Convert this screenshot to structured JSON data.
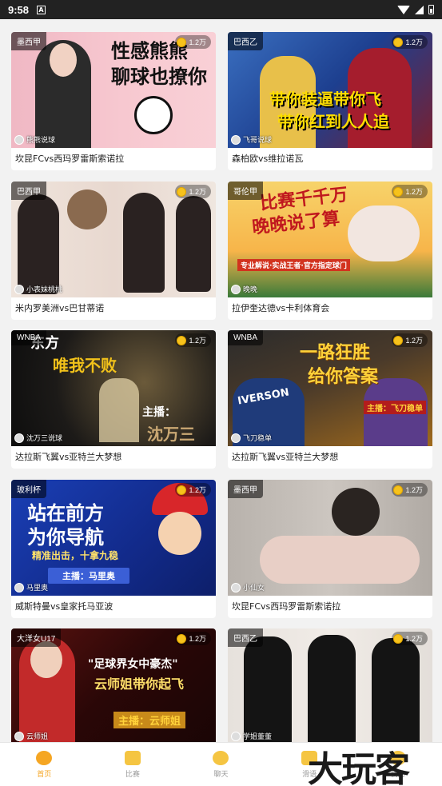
{
  "status_bar": {
    "time": "9:58",
    "notice_icon": "A"
  },
  "cards": [
    {
      "league": "墨西甲",
      "views": "1.2万",
      "anchor": "熊熊说球",
      "title": "坎昆FCvs西玛罗雷斯索诺拉",
      "poster": [
        "性感熊熊",
        "聊球也撩你"
      ]
    },
    {
      "league": "巴西乙",
      "views": "1.2万",
      "anchor": "飞哥说球",
      "title": "森柏欧vs维拉诺瓦",
      "poster": [
        "带你装逼带你飞",
        "带你红到人人追"
      ]
    },
    {
      "league": "巴西甲",
      "views": "1.2万",
      "anchor": "小表妹桃桃",
      "title": "米内罗美洲vs巴甘蒂诺",
      "poster": []
    },
    {
      "league": "哥伦甲",
      "views": "1.2万",
      "anchor": "晚晚",
      "title": "拉伊奎达德vs卡利体育会",
      "poster": [
        "比赛千千万",
        "晚晚说了算",
        "专业解说·实战王者·官方指定球门"
      ]
    },
    {
      "league": "WNBA",
      "views": "1.2万",
      "anchor": "沈万三说球",
      "title": "达拉斯飞翼vs亚特兰大梦想",
      "poster": [
        "东方",
        "唯我不败",
        "主播：",
        "沈万三"
      ]
    },
    {
      "league": "WNBA",
      "views": "1.2万",
      "anchor": "飞刀稳单",
      "title": "达拉斯飞翼vs亚特兰大梦想",
      "poster": [
        "一路狂胜",
        "给你答案",
        "IVERSON",
        "主播：飞刀稳单"
      ]
    },
    {
      "league": "玻利杯",
      "views": "1.2万",
      "anchor": "马里奥",
      "title": "威斯特曼vs皇家托马亚波",
      "poster": [
        "站在前方",
        "为你导航",
        "精准出击，十拿九稳",
        "主播：马里奥"
      ]
    },
    {
      "league": "墨西甲",
      "views": "1.2万",
      "anchor": "小仙女",
      "title": "坎昆FCvs西玛罗雷斯索诺拉",
      "poster": []
    },
    {
      "league": "大洋女U17",
      "views": "1.2万",
      "anchor": "云师姐",
      "title": "",
      "poster": [
        "\"足球界女中豪杰\"",
        "云师姐带你起飞",
        "主播：云师姐"
      ]
    },
    {
      "league": "巴西乙",
      "views": "1.2万",
      "anchor": "学姐董董",
      "title": "",
      "poster": []
    }
  ],
  "tabs": [
    {
      "label": "首页",
      "icon": "home-icon"
    },
    {
      "label": "比赛",
      "icon": "match-icon"
    },
    {
      "label": "聊天",
      "icon": "chat-icon"
    },
    {
      "label": "滑语",
      "icon": "gift-icon"
    },
    {
      "label": "我的",
      "icon": "profile-icon"
    }
  ],
  "watermark": "大玩客",
  "colors": {
    "accent": "#f5a623",
    "coin": "#f6c21c"
  }
}
